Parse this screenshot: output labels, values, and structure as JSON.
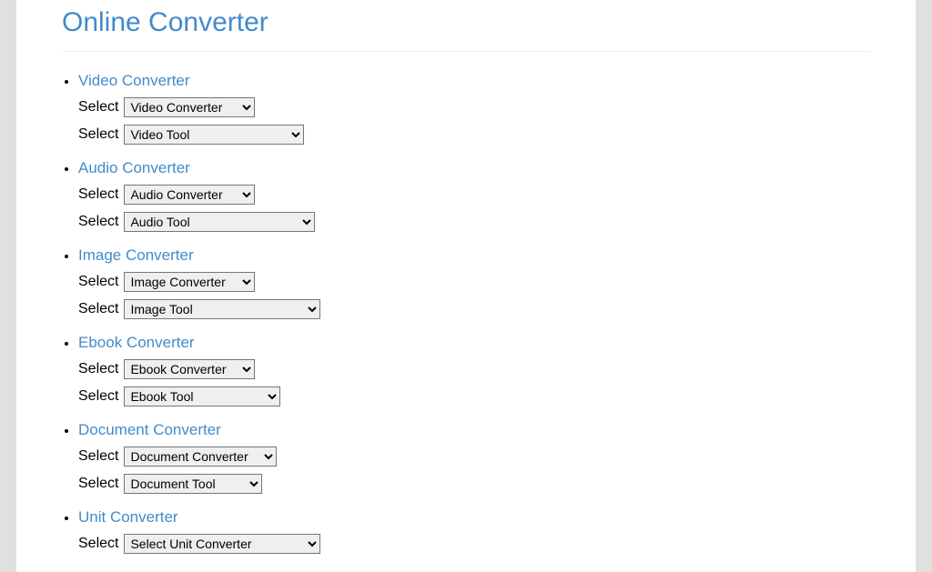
{
  "page": {
    "title": "Online Converter"
  },
  "labels": {
    "select": "Select"
  },
  "sections": [
    {
      "heading": "Video Converter",
      "select1": "Video Converter",
      "select2": "Video Tool",
      "w1": "sel-w1",
      "w2": "sel-w2"
    },
    {
      "heading": "Audio Converter",
      "select1": "Audio Converter",
      "select2": "Audio Tool",
      "w1": "sel-w3",
      "w2": "sel-w4"
    },
    {
      "heading": "Image Converter",
      "select1": "Image Converter",
      "select2": "Image Tool",
      "w1": "sel-w5",
      "w2": "sel-w6"
    },
    {
      "heading": "Ebook Converter",
      "select1": "Ebook Converter",
      "select2": "Ebook Tool",
      "w1": "sel-w7",
      "w2": "sel-w8"
    },
    {
      "heading": "Document Converter",
      "select1": "Document Converter",
      "select2": "Document Tool",
      "w1": "sel-w9",
      "w2": "sel-w10"
    },
    {
      "heading": "Unit Converter",
      "select1": "Select Unit Converter",
      "select2": null,
      "w1": "sel-w11",
      "w2": null
    }
  ]
}
